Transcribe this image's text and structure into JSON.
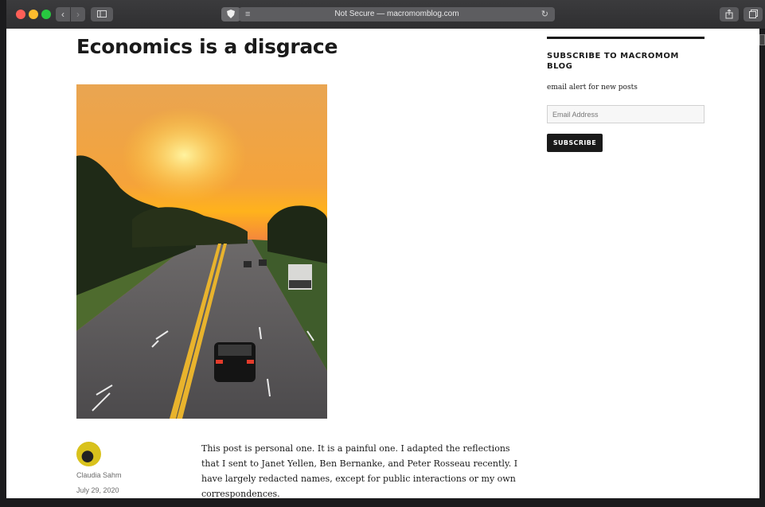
{
  "browser": {
    "address_text": "Not Secure — macromomblog.com",
    "icons": {
      "back": "chevron-left-icon",
      "forward": "chevron-right-icon",
      "sidebar": "sidebar-icon",
      "shield": "shield-icon",
      "reader": "reader-icon",
      "reload": "reload-icon",
      "share": "share-icon",
      "tabs": "tabs-icon"
    }
  },
  "post": {
    "title": "Economics is a disgrace",
    "author": "Claudia Sahm",
    "date": "July 29, 2020",
    "body": "This post is personal one. It is a painful one. I adapted the reflections that I sent to Janet Yellen, Ben Bernanke, and Peter Rosseau recently. I have largely redacted names, except for public interactions or my own correspondences."
  },
  "sidebar": {
    "widget_title": "SUBSCRIBE TO MACROMOM BLOG",
    "widget_desc": "email alert for new posts",
    "email_placeholder": "Email Address",
    "subscribe_label": "SUBSCRIBE"
  },
  "colors": {
    "text": "#1a1a1a",
    "button": "#1a1a1a",
    "toolbar": "#2f2f31"
  }
}
